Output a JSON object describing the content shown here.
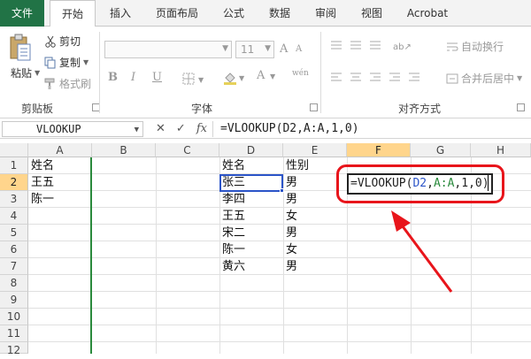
{
  "tabs": [
    "文件",
    "开始",
    "插入",
    "页面布局",
    "公式",
    "数据",
    "审阅",
    "视图",
    "Acrobat"
  ],
  "clipboard": {
    "paste": "粘贴",
    "cut": "剪切",
    "copy": "复制",
    "format_painter": "格式刷",
    "group": "剪贴板"
  },
  "font": {
    "size": "11",
    "group": "字体",
    "bold": "B",
    "italic": "I",
    "underline": "U",
    "grow": "A",
    "shrink": "A",
    "color_a": "A",
    "wen": "wén"
  },
  "alignment": {
    "wrap": "自动换行",
    "merge": "合并后居中",
    "group": "对齐方式"
  },
  "formula_bar": {
    "name_box": "VLOOKUP",
    "cancel": "✕",
    "enter": "✓",
    "fx": "fx",
    "formula": "=VLOOKUP(D2,A:A,1,0)"
  },
  "grid": {
    "columns": [
      "A",
      "B",
      "C",
      "D",
      "E",
      "F",
      "G",
      "H"
    ],
    "selected_column": "F",
    "rows": [
      "1",
      "2",
      "3",
      "4",
      "5",
      "6",
      "7",
      "8",
      "9",
      "10",
      "11",
      "12"
    ],
    "selected_row": "2",
    "cells": {
      "A1": "姓名",
      "A2": "王五",
      "A3": "陈一",
      "D1": "姓名",
      "D2": "张三",
      "D3": "李四",
      "D4": "王五",
      "D5": "宋二",
      "D6": "陈一",
      "D7": "黄六",
      "E1": "性别",
      "E2": "男",
      "E3": "男",
      "E4": "女",
      "E5": "男",
      "E6": "女",
      "E7": "男"
    },
    "editing": {
      "prefix": "=VLOOKUP(",
      "ref1": "D2",
      "comma1": ",",
      "ref2": "A:A",
      "suffix": ",1,0)"
    }
  },
  "colors": {
    "accent": "#217346",
    "highlight": "#e8151b",
    "selection": "#2b54c8",
    "ref_green": "#2a8a3c"
  }
}
